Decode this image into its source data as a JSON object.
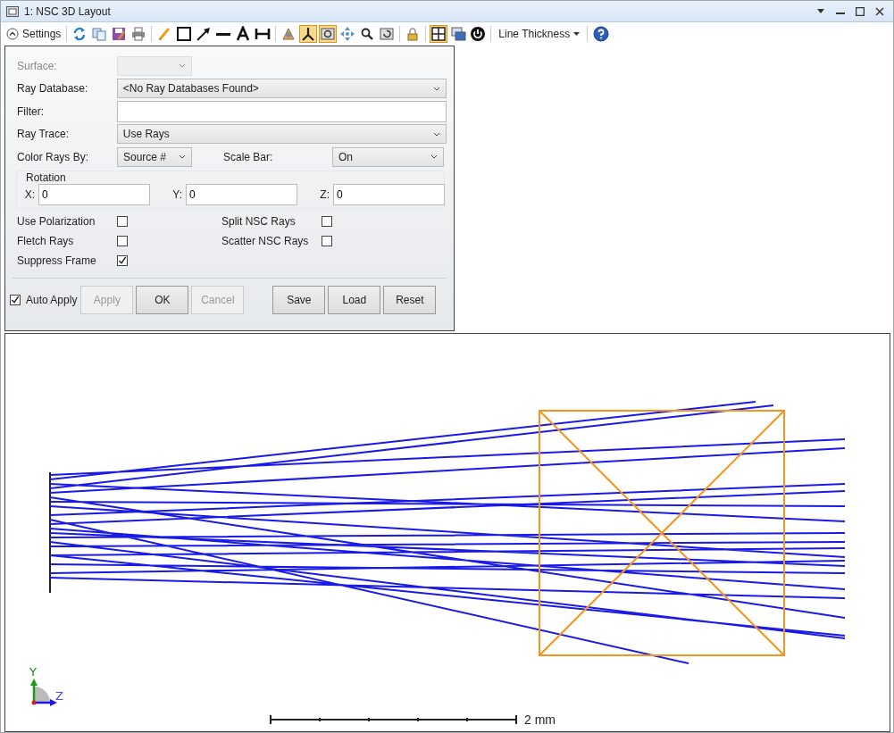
{
  "window": {
    "title": "1: NSC 3D Layout"
  },
  "toolbar": {
    "settings_label": "Settings",
    "tool_groups": [
      [
        {
          "kind": "refresh",
          "selected": false
        },
        {
          "kind": "copy",
          "selected": false
        },
        {
          "kind": "save",
          "selected": false
        },
        {
          "kind": "printer",
          "selected": false
        }
      ],
      [
        {
          "kind": "pencil",
          "selected": false
        },
        {
          "kind": "rectangle",
          "selected": false
        },
        {
          "kind": "arrow",
          "selected": false
        },
        {
          "kind": "line",
          "selected": false
        },
        {
          "kind": "text",
          "selected": false
        },
        {
          "kind": "dimension",
          "selected": false
        }
      ],
      [
        {
          "kind": "rotate-menu",
          "selected": false
        },
        {
          "kind": "axes",
          "selected": true
        },
        {
          "kind": "rotate-view",
          "selected": true
        },
        {
          "kind": "pan",
          "selected": false
        },
        {
          "kind": "zoom",
          "selected": false
        },
        {
          "kind": "undo-zoom",
          "selected": false
        }
      ],
      [
        {
          "kind": "lock",
          "selected": false
        }
      ],
      [
        {
          "kind": "frame",
          "selected": true
        },
        {
          "kind": "windows",
          "selected": false
        },
        {
          "kind": "power",
          "selected": false
        }
      ]
    ],
    "line_thickness": "Line Thickness"
  },
  "settings": {
    "surface": {
      "label": "Surface:",
      "disabled": true
    },
    "ray_database": {
      "label": "Ray Database:",
      "value": "<No Ray Databases Found>"
    },
    "filter": {
      "label": "Filter:"
    },
    "ray_trace": {
      "label": "Ray Trace:",
      "value": "Use Rays"
    },
    "color_rays_by": {
      "label": "Color Rays By:",
      "value": "Source #"
    },
    "scale_bar": {
      "label": "Scale Bar:",
      "value": "On"
    },
    "rotation": {
      "title": "Rotation",
      "axes": [
        {
          "label": "X:",
          "value": "0"
        },
        {
          "label": "Y:",
          "value": "0"
        },
        {
          "label": "Z:",
          "value": "0"
        }
      ]
    },
    "checkboxes": [
      {
        "label": "Use Polarization",
        "checked": false
      },
      {
        "label": "Split NSC Rays",
        "checked": false
      },
      {
        "label": "Fletch Rays",
        "checked": false
      },
      {
        "label": "Scatter NSC Rays",
        "checked": false
      },
      {
        "label": "Suppress Frame",
        "checked": true
      }
    ],
    "auto_apply": {
      "label": "Auto Apply",
      "checked": true
    },
    "buttons": [
      {
        "label": "Apply",
        "disabled": true
      },
      {
        "label": "OK",
        "disabled": false
      },
      {
        "label": "Cancel",
        "disabled": true
      },
      {
        "label": "Save",
        "disabled": false
      },
      {
        "label": "Load",
        "disabled": false
      },
      {
        "label": "Reset",
        "disabled": false
      }
    ]
  },
  "plot": {
    "axis_labels": [
      "Y",
      "Z"
    ],
    "scale_label": "2 mm"
  }
}
